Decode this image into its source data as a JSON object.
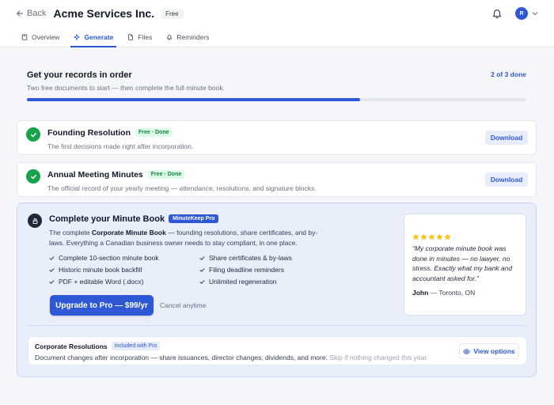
{
  "header": {
    "back_label": "Back",
    "company_name": "Acme Services Inc.",
    "plan_badge": "Free",
    "avatar_initial": "R"
  },
  "tabs": [
    {
      "label": "Overview",
      "icon": "book-icon",
      "active": false
    },
    {
      "label": "Generate",
      "icon": "sparkle-icon",
      "active": true
    },
    {
      "label": "Files",
      "icon": "file-icon",
      "active": false
    },
    {
      "label": "Reminders",
      "icon": "bell-icon",
      "active": false
    }
  ],
  "progress": {
    "title": "Get your records in order",
    "subtitle": "Two free documents to start — then complete the full minute book.",
    "count_label": "2 of 3 done",
    "completed": 2,
    "total": 3
  },
  "documents": [
    {
      "title": "Founding Resolution",
      "badge": "Free · Done",
      "description": "The first decisions made right after incorporation.",
      "action": "Download"
    },
    {
      "title": "Annual Meeting Minutes",
      "badge": "Free · Done",
      "description": "The official record of your yearly meeting — attendance, resolutions, and signature blocks.",
      "action": "Download"
    }
  ],
  "pro": {
    "title": "Complete your Minute Book",
    "badge": "MinuteKeep Pro",
    "desc_prefix": "The complete ",
    "desc_bold": "Corporate Minute Book",
    "desc_suffix": " — founding resolutions, share certificates, and by-laws. Everything a Canadian business owner needs to stay compliant, in one place.",
    "features": [
      "Complete 10-section minute book",
      "Share certificates & by-laws",
      "Historic minute book backfill",
      "Filing deadline reminders",
      "PDF + editable Word (.docx)",
      "Unlimited regeneration"
    ],
    "upgrade_label": "Upgrade to Pro — $99/yr",
    "cancel_label": "Cancel anytime",
    "testimonial": {
      "rating": 5,
      "quote": "“My corporate minute book was done in minutes — no lawyer, no stress. Exactly what my bank and accountant asked for.”",
      "author_name": "John",
      "author_location": " — Toronto, ON"
    }
  },
  "corporate": {
    "title": "Corporate Resolutions",
    "badge": "Included with Pro",
    "description": "Document changes after incorporation — share issuances, director changes, dividends, and more.",
    "hint": " Skip if nothing changed this year.",
    "action": "View options"
  },
  "colors": {
    "accent": "#2f58d6",
    "success": "#16a34a",
    "star": "#f5c518"
  }
}
